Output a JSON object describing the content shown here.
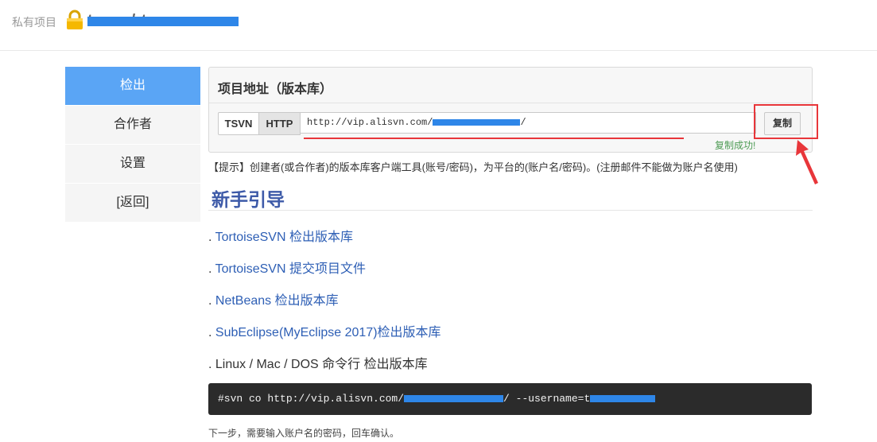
{
  "header": {
    "private_label": "私有项目",
    "project_name_visible": "t  .  .  ·  /  t  ·"
  },
  "sidebar": {
    "items": [
      {
        "label": "检出",
        "active": true
      },
      {
        "label": "合作者",
        "active": false
      },
      {
        "label": "设置",
        "active": false
      },
      {
        "label": "[返回]",
        "active": false
      }
    ]
  },
  "repo_panel": {
    "title": "项目地址（版本库）",
    "protocols": [
      "TSVN",
      "HTTP"
    ],
    "selected_protocol": "HTTP",
    "url_prefix": "http://vip.alisvn.com/",
    "url_suffix": "/",
    "copy_label": "复制",
    "copy_success": "复制成功!"
  },
  "hint": "【提示】创建者(或合作者)的版本库客户端工具(账号/密码)，为平台的(账户名/密码)。(注册邮件不能做为账户名使用)",
  "guide": {
    "title": "新手引导",
    "items": [
      {
        "prefix": ". ",
        "link": "TortoiseSVN 检出版本库",
        "plain": ""
      },
      {
        "prefix": ". ",
        "link": "TortoiseSVN 提交项目文件",
        "plain": ""
      },
      {
        "prefix": ". ",
        "link": "NetBeans 检出版本库",
        "plain": ""
      },
      {
        "prefix": ". ",
        "link": "SubEclipse(MyEclipse 2017)",
        "plain": "检出版本库"
      },
      {
        "prefix": ". ",
        "link": "",
        "plain": "Linux / Mac / DOS 命令行 检出版本库"
      }
    ]
  },
  "command": {
    "prefix": "#svn co http://vip.alisvn.com/",
    "middle": "/ --username=t"
  },
  "footer_note": "下一步，需要输入账户名的密码，回车确认。",
  "colors": {
    "sidebar_active": "#5aa5f5",
    "link": "#2e5fb5",
    "guide_title": "#3d5aa8",
    "annotation_red": "#e8363a",
    "redaction_blue": "#2e86e8",
    "success_green": "#4d9b54"
  }
}
